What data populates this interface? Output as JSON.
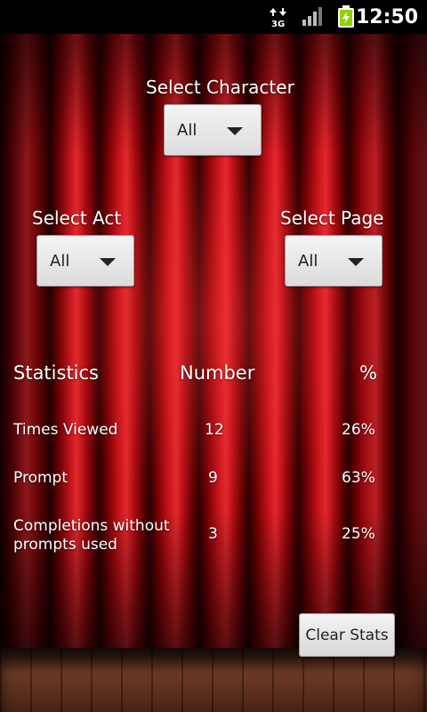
{
  "status_bar": {
    "network_type": "3G",
    "time": "12:50",
    "icons": [
      "data-transfer-icon",
      "signal-strength-icon",
      "battery-charging-icon"
    ]
  },
  "selectors": {
    "character": {
      "label": "Select Character",
      "value": "All"
    },
    "act": {
      "label": "Select Act",
      "value": "All"
    },
    "page": {
      "label": "Select Page",
      "value": "All"
    }
  },
  "stats": {
    "headers": [
      "Statistics",
      "Number",
      "%"
    ],
    "rows": [
      {
        "name": "Times Viewed",
        "number": "12",
        "percent": "26%"
      },
      {
        "name": "Prompt",
        "number": "9",
        "percent": "63%"
      },
      {
        "name": "Completions without prompts used",
        "number": "3",
        "percent": "25%"
      }
    ]
  },
  "actions": {
    "clear_label": "Clear Stats"
  },
  "colors": {
    "curtain": "#c7141b",
    "status_bar": "#000000",
    "battery": "#8fd400"
  }
}
